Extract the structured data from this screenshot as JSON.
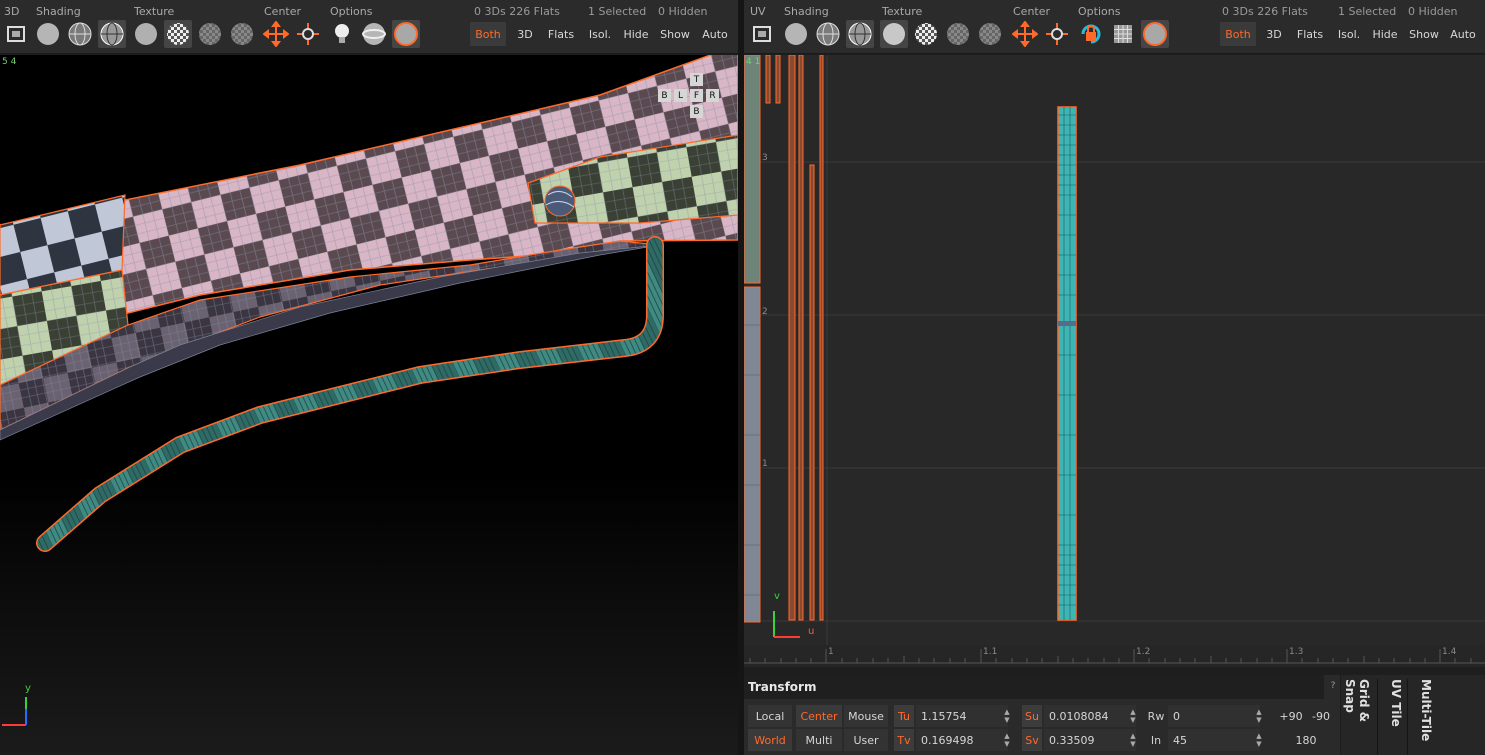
{
  "left_toolbar": {
    "groups": {
      "g3d": "3D",
      "shading": "Shading",
      "texture": "Texture",
      "center": "Center",
      "options": "Options"
    },
    "stats": {
      "count": "0 3Ds 226 Flats",
      "selected": "1 Selected",
      "hidden": "0 Hidden"
    },
    "buttons": {
      "both": "Both",
      "three_d": "3D",
      "flats": "Flats",
      "isol": "Isol.",
      "hide": "Hide",
      "show": "Show",
      "auto": "Auto"
    }
  },
  "right_toolbar": {
    "groups": {
      "uv": "UV",
      "shading": "Shading",
      "texture": "Texture",
      "center": "Center",
      "options": "Options"
    },
    "stats": {
      "count": "0 3Ds 226 Flats",
      "selected": "1 Selected",
      "hidden": "0 Hidden"
    },
    "buttons": {
      "both": "Both",
      "three_d": "3D",
      "flats": "Flats",
      "isol": "Isol.",
      "hide": "Hide",
      "show": "Show",
      "auto": "Auto"
    }
  },
  "viewport3d": {
    "corner_numbers": "5 4",
    "nav_cube": {
      "top": "T",
      "back": "B",
      "left": "L",
      "front": "F",
      "right": "R",
      "bottom": "B"
    },
    "axis": {
      "y": "y"
    }
  },
  "uv_view": {
    "corner_numbers": "4 1",
    "v_marks": [
      "3",
      "2",
      "1"
    ],
    "u_marks": [
      "1",
      "1.1",
      "1.2",
      "1.3",
      "1.4"
    ],
    "axis": {
      "u": "u",
      "v": "v"
    }
  },
  "transform_panel": {
    "title": "Transform",
    "help": "?",
    "local": "Local",
    "center": "Center",
    "mouse": "Mouse",
    "world": "World",
    "multi": "Multi",
    "user": "User",
    "tu_label": "Tu",
    "tu_value": "1.15754",
    "tv_label": "Tv",
    "tv_value": "0.169498",
    "su_label": "Su",
    "su_value": "0.0108084",
    "sv_label": "Sv",
    "sv_value": "0.33509",
    "rw_label": "Rw",
    "rw_value": "0",
    "in_label": "In",
    "in_value": "45",
    "plus90": "+90",
    "minus90": "-90",
    "r180": "180"
  },
  "side_tabs": {
    "grid_snap": "Grid & Snap",
    "uv_tile": "UV Tile",
    "multi_tile": "Multi-Tile"
  },
  "colors": {
    "accent": "#ff6a2b",
    "uv_shell": "#3fb4b4",
    "checker_pink": "#d9b6c6",
    "checker_green": "#bfd2ad"
  }
}
